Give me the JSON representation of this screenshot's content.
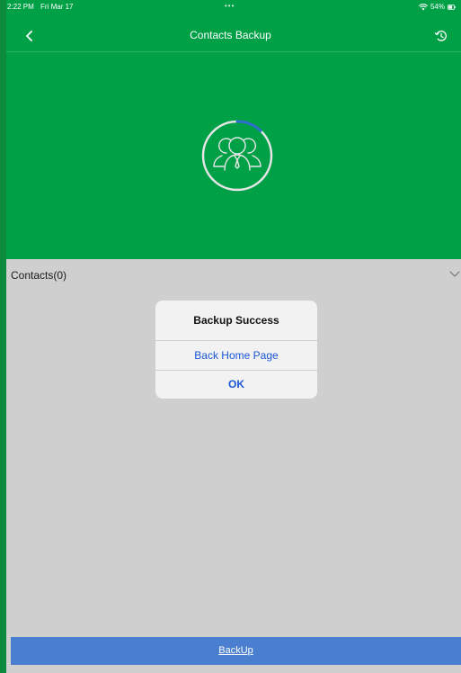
{
  "status_bar": {
    "time": "2:22 PM",
    "date": "Fri Mar 17",
    "dots": "•••",
    "battery": "54%",
    "wifi_icon": "wifi-icon",
    "battery_icon": "battery-icon"
  },
  "nav": {
    "title": "Contacts Backup",
    "back_icon": "chevron-left-icon",
    "history_icon": "history-icon"
  },
  "progress": {
    "icon": "contacts-group-icon",
    "fraction": 0.12
  },
  "contacts": {
    "label": "Contacts(0)",
    "chevron_icon": "chevron-down-icon"
  },
  "dialog": {
    "title": "Backup Success",
    "back_home_label": "Back Home Page",
    "ok_label": "OK"
  },
  "footer": {
    "backup_label": "BackUp"
  },
  "colors": {
    "header_green": "#00a046",
    "content_gray": "#cfcfcf",
    "accent_blue": "#4a7fd0",
    "dialog_link_blue": "#1a56d6"
  }
}
